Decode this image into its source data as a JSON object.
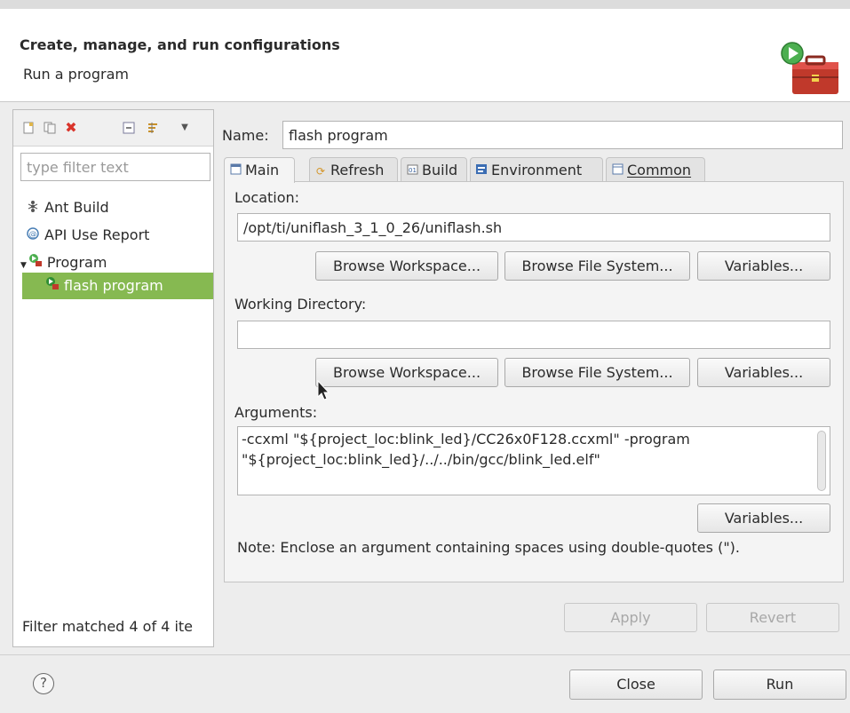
{
  "header": {
    "title": "Create, manage, and run configurations",
    "subtitle": "Run a program"
  },
  "left": {
    "toolbar_icons": [
      "new-config-icon",
      "duplicate-icon",
      "delete-icon",
      "collapse-all-icon",
      "filter-icon",
      "menu-dropdown-icon"
    ],
    "filter_placeholder": "type filter text",
    "tree": [
      {
        "label": "Ant Build",
        "icon": "ant-build-icon"
      },
      {
        "label": "API Use Report",
        "icon": "api-report-icon"
      },
      {
        "label": "Program",
        "icon": "program-icon",
        "expanded": true
      },
      {
        "label": "flash program",
        "icon": "program-config-icon",
        "selected": true
      }
    ],
    "filter_status": "Filter matched 4 of 4 ite"
  },
  "config": {
    "name_label": "Name:",
    "name_value": "flash program",
    "tabs": [
      {
        "label": "Main",
        "icon": "main-tab-icon",
        "active": true
      },
      {
        "label": "Refresh",
        "icon": "refresh-tab-icon"
      },
      {
        "label": "Build",
        "icon": "build-tab-icon"
      },
      {
        "label": "Environment",
        "icon": "environment-tab-icon"
      },
      {
        "label": "Common",
        "icon": "common-tab-icon"
      }
    ],
    "location": {
      "label": "Location:",
      "value": "/opt/ti/uniflash_3_1_0_26/uniflash.sh",
      "browse_workspace": "Browse Workspace...",
      "browse_fs": "Browse File System...",
      "variables": "Variables..."
    },
    "workdir": {
      "label": "Working Directory:",
      "value": "",
      "browse_workspace": "Browse Workspace...",
      "browse_fs": "Browse File System...",
      "variables": "Variables..."
    },
    "arguments": {
      "label": "Arguments:",
      "line1": "-ccxml \"${project_loc:blink_led}/CC26x0F128.ccxml\" -program",
      "line2": "\"${project_loc:blink_led}/../../bin/gcc/blink_led.elf\"",
      "variables": "Variables...",
      "note": "Note: Enclose an argument containing spaces using double-quotes (\")."
    },
    "apply": "Apply",
    "revert": "Revert"
  },
  "footer": {
    "help": "?",
    "close": "Close",
    "run": "Run"
  }
}
